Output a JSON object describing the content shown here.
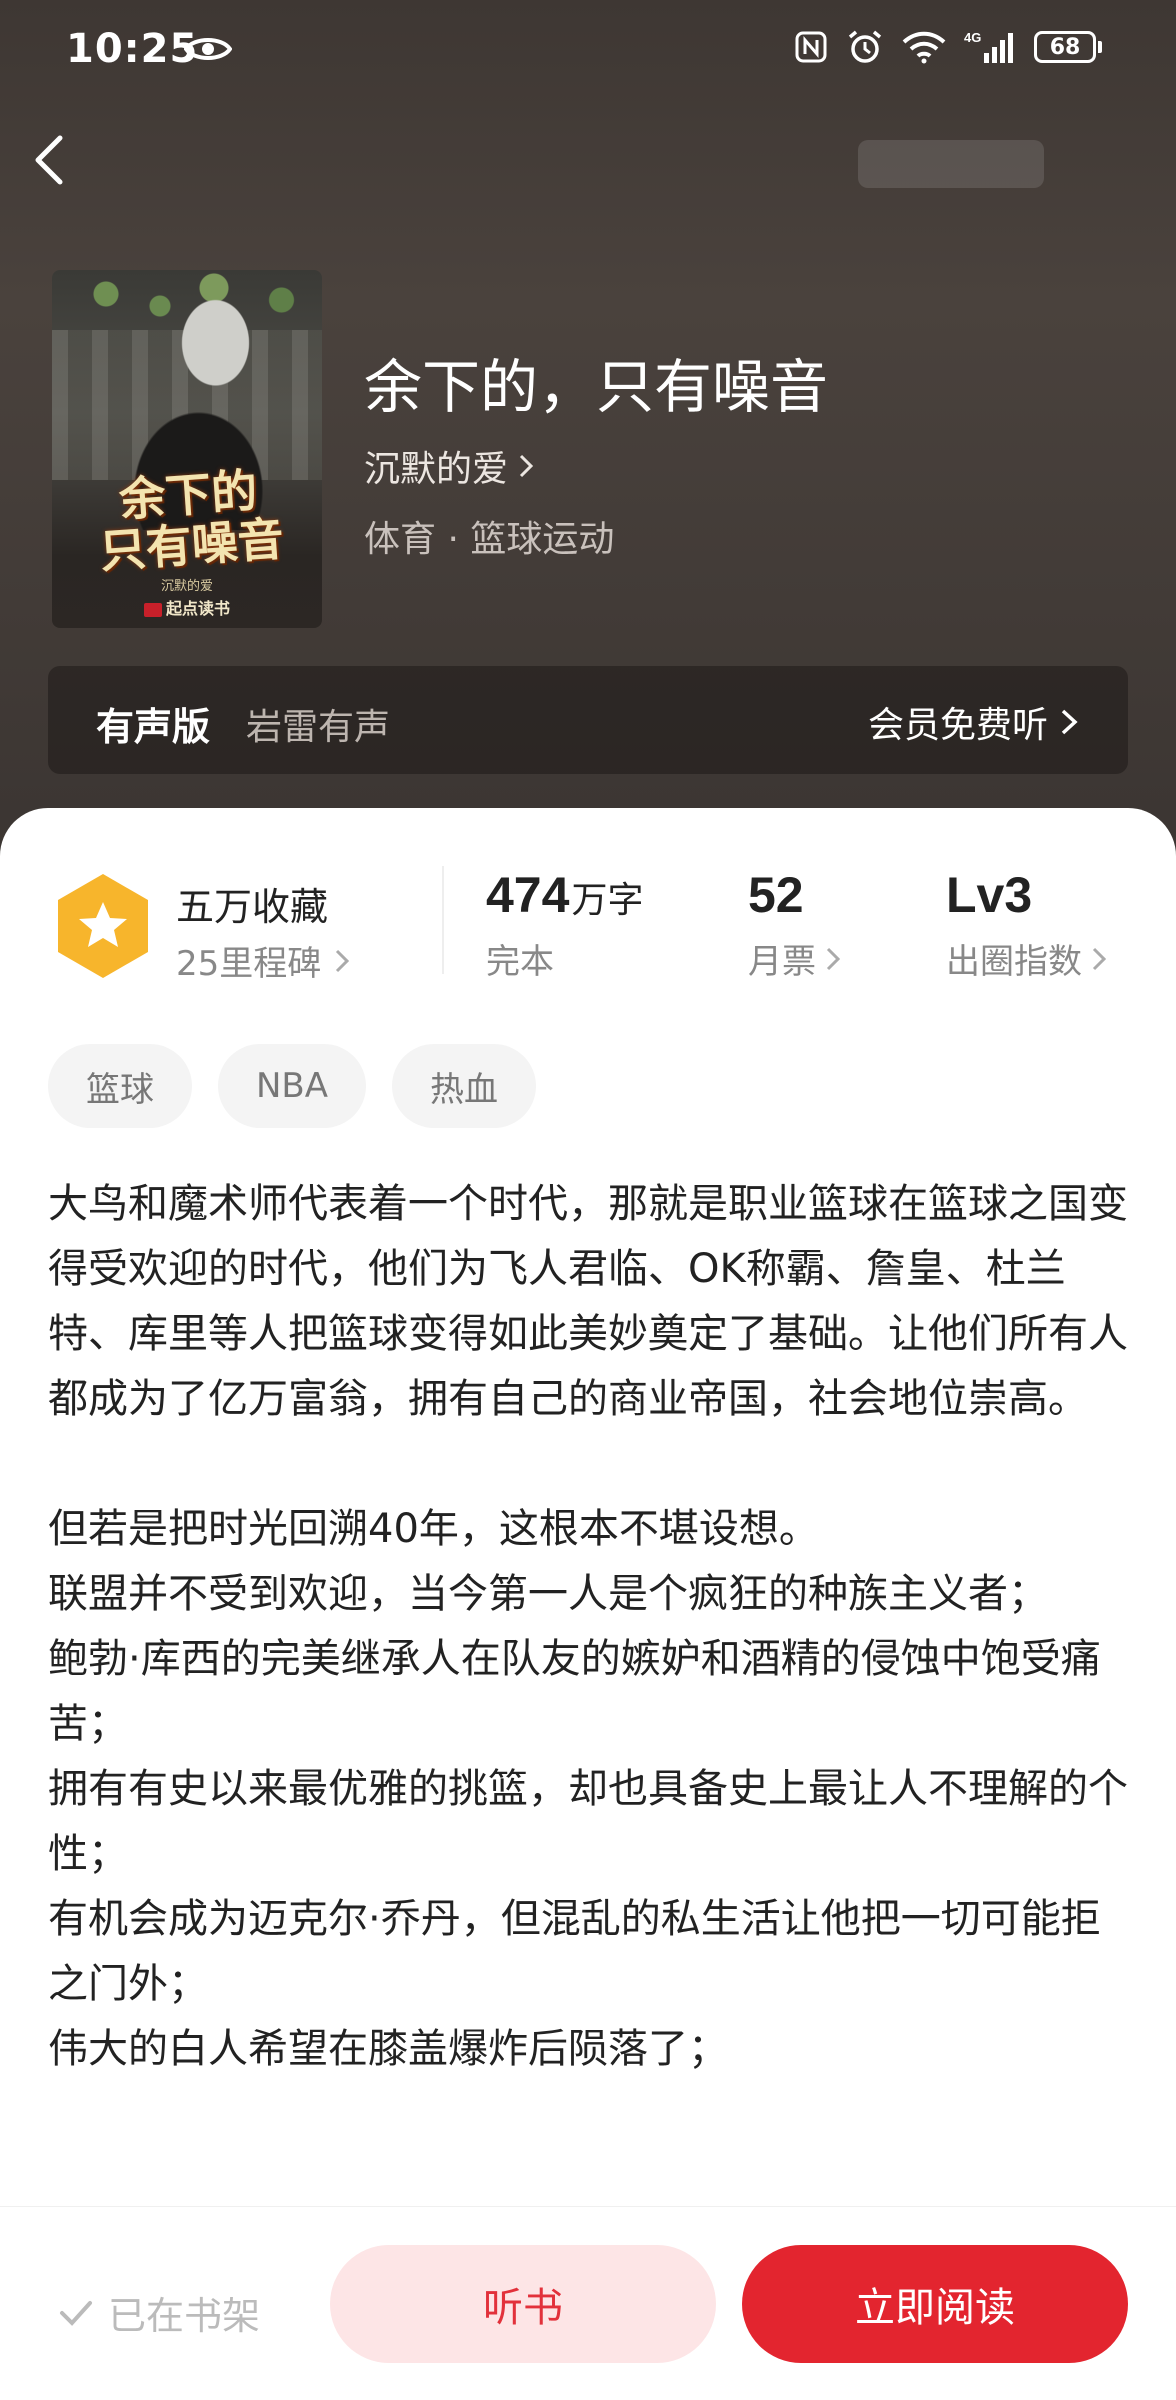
{
  "status_bar": {
    "time": "10:25",
    "battery": "68"
  },
  "book": {
    "title": "余下的，只有噪音",
    "author": "沉默的爱",
    "category": "体育 · 篮球运动",
    "cover": {
      "title_line1": "余下的",
      "title_line2": "只有噪音",
      "author": "沉默的爱",
      "publisher": "起点读书"
    }
  },
  "audio": {
    "label": "有声版",
    "producer": "岩雷有声",
    "link": "会员免费听"
  },
  "stats": {
    "collection": {
      "main": "五万收藏",
      "sub": "25里程碑"
    },
    "words": {
      "value": "474",
      "unit": "万字",
      "label": "完本"
    },
    "tickets": {
      "value": "52",
      "label": "月票"
    },
    "level": {
      "value": "Lv3",
      "label": "出圈指数"
    }
  },
  "tags": [
    "篮球",
    "NBA",
    "热血"
  ],
  "synopsis": "大鸟和魔术师代表着一个时代，那就是职业篮球在篮球之国变得受欢迎的时代，他们为飞人君临、OK称霸、詹皇、杜兰特、库里等人把篮球变得如此美妙奠定了基础。让他们所有人都成为了亿万富翁，拥有自己的商业帝国，社会地位崇高。\n\n但若是把时光回溯40年，这根本不堪设想。\n联盟并不受到欢迎，当今第一人是个疯狂的种族主义者；\n鲍勃·库西的完美继承人在队友的嫉妒和酒精的侵蚀中饱受痛苦；\n拥有有史以来最优雅的挑篮，却也具备史上最让人不理解的个性；\n有机会成为迈克尔·乔丹，但混乱的私生活让他把一切可能拒之门外；\n伟大的白人希望在膝盖爆炸后陨落了；",
  "bottom": {
    "shelf": "已在书架",
    "listen": "听书",
    "read": "立即阅读"
  },
  "colors": {
    "accent": "#e3252f",
    "accent_light": "#fde5e6",
    "header_bg": "#433b37"
  }
}
